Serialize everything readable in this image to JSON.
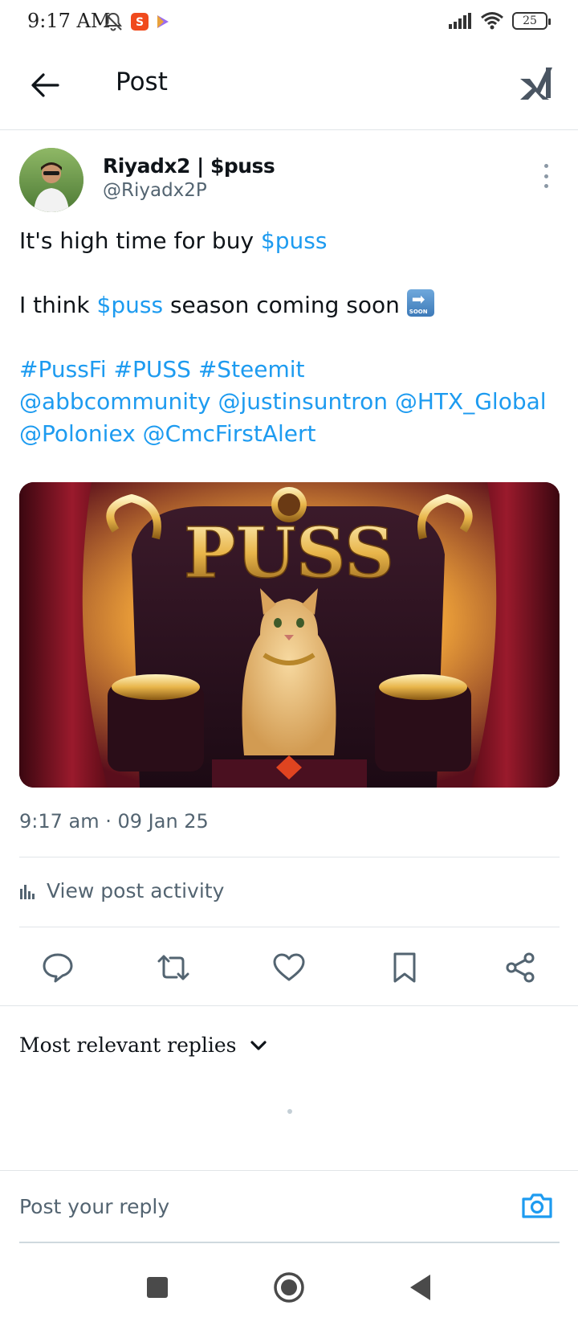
{
  "status_bar": {
    "time": "9:17 AM",
    "battery": "25",
    "icons": [
      "muted-bell-icon",
      "app-badge-icon",
      "play-store-icon",
      "signal-icon",
      "wifi-icon",
      "battery-icon"
    ]
  },
  "header": {
    "title": "Post",
    "back_icon": "arrow-left-icon",
    "brand_icon": "x-logo-icon"
  },
  "post": {
    "author_name": "Riyadx2 | $puss",
    "author_handle": "@Riyadx2P",
    "line1_text": "It's high time for buy ",
    "line1_link": "$puss",
    "line2_a": "I think ",
    "line2_link": "$puss",
    "line2_b": " season coming soon ",
    "soon_emoji_text": "SOON",
    "hashtags": [
      "#PussFi",
      "#PUSS",
      "#Steemit"
    ],
    "mentions_line1": [
      "@abbcommunity",
      "@justinsuntron",
      "@HTX_Global"
    ],
    "mentions_line2": [
      "@Poloniex",
      "@CmcFirstAlert"
    ],
    "image_text": "PUSS",
    "timestamp": "9:17 am · 09 Jan 25"
  },
  "activity": {
    "label": "View post activity"
  },
  "actions": [
    "reply-icon",
    "repost-icon",
    "like-icon",
    "bookmark-icon",
    "share-icon"
  ],
  "replies": {
    "sort_label": "Most relevant replies"
  },
  "reply_bar": {
    "placeholder": "Post your reply"
  },
  "colors": {
    "accent": "#1d9bf0",
    "text": "#0f1419",
    "secondary": "#536471",
    "divider": "#e1e5e8"
  }
}
